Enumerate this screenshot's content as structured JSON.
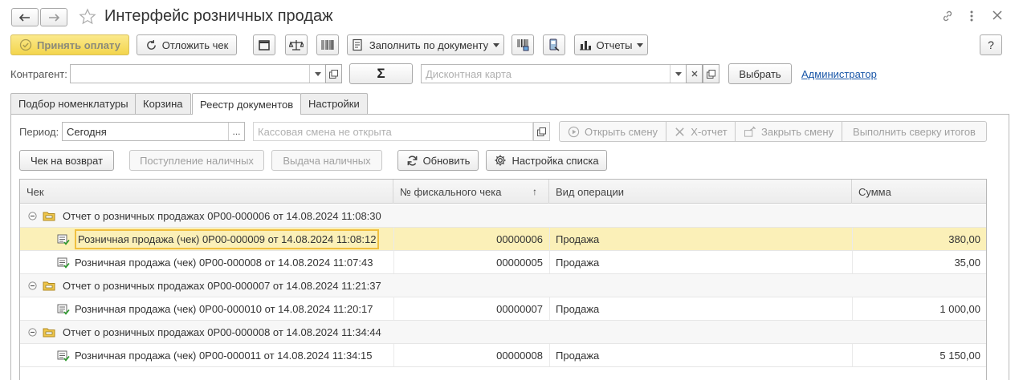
{
  "window": {
    "title": "Интерфейс розничных продаж"
  },
  "toolbar": {
    "accept_payment": "Принять оплату",
    "defer_check": "Отложить чек",
    "fill_by_doc": "Заполнить по документу",
    "reports": "Отчеты",
    "help": "?"
  },
  "filters": {
    "contractor_label": "Контрагент:",
    "contractor_value": "",
    "sigma": "Σ",
    "discount_placeholder": "Дисконтная карта",
    "select_button": "Выбрать",
    "admin_link": "Администратор"
  },
  "tabs": [
    {
      "label": "Подбор номенклатуры"
    },
    {
      "label": "Корзина"
    },
    {
      "label": "Реестр документов"
    },
    {
      "label": "Настройки"
    }
  ],
  "register": {
    "period_label": "Период:",
    "period_value": "Сегодня",
    "shift_placeholder": "Кассовая смена не открыта",
    "open_shift": "Открыть смену",
    "x_report": "Х-отчет",
    "close_shift": "Закрыть смену",
    "reconcile": "Выполнить сверку итогов",
    "return_check": "Чек на возврат",
    "cash_in": "Поступление наличных",
    "cash_out": "Выдача наличных",
    "refresh": "Обновить",
    "list_settings": "Настройка списка"
  },
  "table": {
    "columns": [
      "Чек",
      "№ фискального чека",
      "Вид операции",
      "Сумма"
    ],
    "sort_indicator": "↑",
    "rows": [
      {
        "type": "group",
        "check": "Отчет о розничных продажах 0Р00-000006 от 14.08.2024 11:08:30",
        "fiscal": "",
        "op": "",
        "sum": ""
      },
      {
        "type": "item",
        "check": "Розничная продажа (чек) 0Р00-000009 от 14.08.2024 11:08:12",
        "fiscal": "00000006",
        "op": "Продажа",
        "sum": "380,00",
        "selected": true
      },
      {
        "type": "item",
        "check": "Розничная продажа (чек) 0Р00-000008 от 14.08.2024 11:07:43",
        "fiscal": "00000005",
        "op": "Продажа",
        "sum": "35,00"
      },
      {
        "type": "group",
        "check": "Отчет о розничных продажах 0Р00-000007 от 14.08.2024 11:21:37",
        "fiscal": "",
        "op": "",
        "sum": ""
      },
      {
        "type": "item",
        "check": "Розничная продажа (чек) 0Р00-000010 от 14.08.2024 11:20:17",
        "fiscal": "00000007",
        "op": "Продажа",
        "sum": "1 000,00"
      },
      {
        "type": "group",
        "check": "Отчет о розничных продажах 0Р00-000008 от 14.08.2024 11:34:44",
        "fiscal": "",
        "op": "",
        "sum": ""
      },
      {
        "type": "item",
        "check": "Розничная продажа (чек) 0Р00-000011 от 14.08.2024 11:34:15",
        "fiscal": "00000008",
        "op": "Продажа",
        "sum": "5 150,00"
      }
    ]
  },
  "colors": {
    "accent_yellow": "#f3d54c",
    "selected_row": "#fbf0b8",
    "link": "#1a57a8"
  }
}
